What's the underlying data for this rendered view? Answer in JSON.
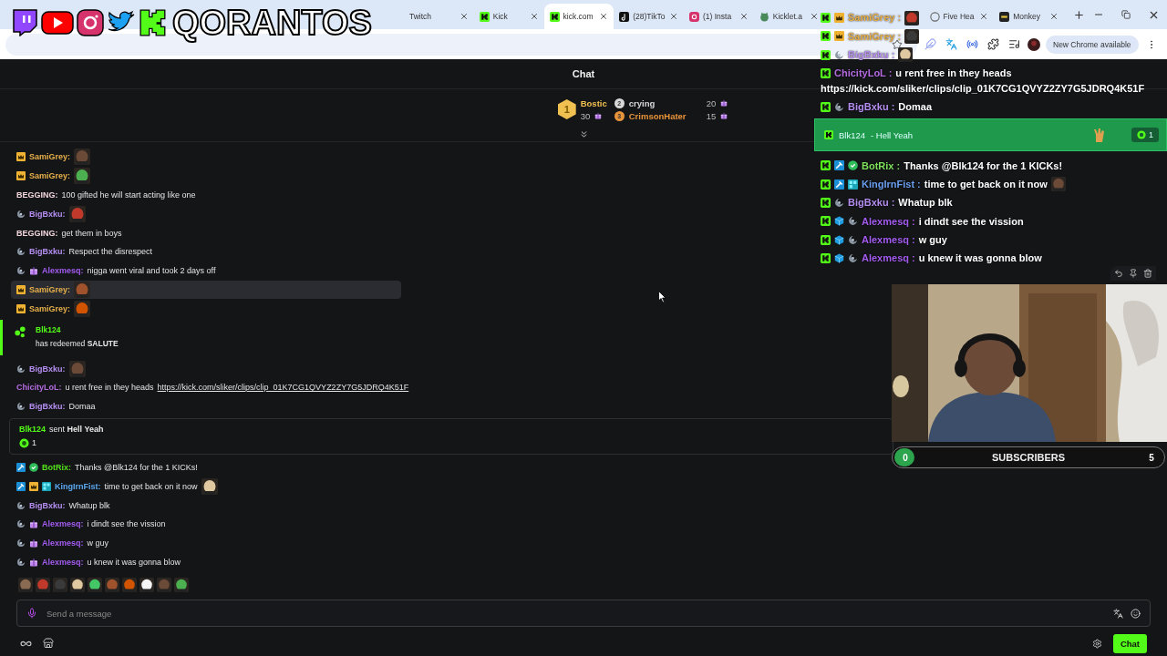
{
  "browser": {
    "tabs": [
      {
        "label": "Twitch",
        "selected": false
      },
      {
        "label": "Kick",
        "selected": false
      },
      {
        "label": "kick.com",
        "selected": true
      },
      {
        "label": "(28)TikTo",
        "selected": false
      },
      {
        "label": "(1) Insta",
        "selected": false
      },
      {
        "label": "Kicklet.a",
        "selected": false
      },
      {
        "label": "Five Hea",
        "selected": false
      },
      {
        "label": "Monkey",
        "selected": false
      }
    ],
    "update_button": "New Chrome available"
  },
  "overlay": {
    "logo": "QORANTOS",
    "chat": [
      {
        "kind": "message",
        "badges": [
          {
            "kind": "kick"
          },
          {
            "kind": "crown"
          }
        ],
        "user": "SamiGrey :",
        "color": "#e8b04a",
        "emote": true
      },
      {
        "kind": "message",
        "badges": [
          {
            "kind": "kick"
          },
          {
            "kind": "crown"
          }
        ],
        "user": "SamiGrey :",
        "color": "#e8b04a",
        "emote": true
      },
      {
        "kind": "message",
        "badges": [
          {
            "kind": "kick"
          },
          {
            "kind": "sub"
          }
        ],
        "user": "BigBxku :",
        "color": "#b48ef0",
        "emote": true
      },
      {
        "kind": "message",
        "badges": [
          {
            "kind": "kick"
          }
        ],
        "user": "ChicityLoL :",
        "color": "#b36be0",
        "text": "u rent free in they heads",
        "link": "https://kick.com/sliker/clips/clip_01K7CG1QVYZ2ZY7G5JDRQ4K51F"
      },
      {
        "kind": "message",
        "badges": [
          {
            "kind": "kick"
          },
          {
            "kind": "sub"
          }
        ],
        "user": "BigBxku :",
        "color": "#b48ef0",
        "text": "Domaa"
      },
      {
        "kind": "alert",
        "user": "Blk124",
        "text": "- Hell Yeah",
        "count": "1"
      },
      {
        "kind": "message",
        "badges": [
          {
            "kind": "kick"
          },
          {
            "kind": "mod"
          },
          {
            "kind": "verified"
          }
        ],
        "user": "BotRix :",
        "color": "#7ee05a",
        "text": "Thanks @Blk124 for the 1 KICKs!"
      },
      {
        "kind": "message",
        "badges": [
          {
            "kind": "kick"
          },
          {
            "kind": "mod"
          },
          {
            "kind": "og"
          }
        ],
        "user": "KingIrnFist :",
        "color": "#6b9ff0",
        "text": "time to get back on it now",
        "emote": true
      },
      {
        "kind": "message",
        "badges": [
          {
            "kind": "kick"
          },
          {
            "kind": "sub"
          }
        ],
        "user": "BigBxku :",
        "color": "#b48ef0",
        "text": "Whatup blk"
      },
      {
        "kind": "message",
        "badges": [
          {
            "kind": "kick"
          },
          {
            "kind": "gem"
          },
          {
            "kind": "sub"
          }
        ],
        "user": "Alexmesq :",
        "color": "#a35cf0",
        "text": "i dindt see the vission"
      },
      {
        "kind": "message",
        "badges": [
          {
            "kind": "kick"
          },
          {
            "kind": "gem"
          },
          {
            "kind": "sub"
          }
        ],
        "user": "Alexmesq :",
        "color": "#a35cf0",
        "text": "w guy"
      },
      {
        "kind": "message",
        "badges": [
          {
            "kind": "kick"
          },
          {
            "kind": "gem"
          },
          {
            "kind": "sub"
          }
        ],
        "user": "Alexmesq :",
        "color": "#a35cf0",
        "text": "u knew it was gonna blow"
      }
    ],
    "subscribers": {
      "current": "0",
      "label": "SUBSCRIBERS",
      "goal": "5",
      "level": 0
    }
  },
  "chat": {
    "title": "Chat",
    "leaderboard": [
      {
        "rank": "1",
        "name": "Bostic",
        "count": "30",
        "color": "#f0c050"
      },
      {
        "rank": "2",
        "name": "crying",
        "count": "20",
        "color": "#d8d8d8"
      },
      {
        "rank": "3",
        "name": "CrimsonHater",
        "count": "15",
        "color": "#e8943a"
      }
    ],
    "messages": [
      {
        "kind": "message",
        "badges": [
          {
            "kind": "crown"
          }
        ],
        "user": "SamiGrey:",
        "color": "#e8b04a",
        "emote": true,
        "selected": false
      },
      {
        "kind": "message",
        "badges": [
          {
            "kind": "crown"
          }
        ],
        "user": "SamiGrey:",
        "color": "#e8b04a",
        "emote": true,
        "selected": false
      },
      {
        "kind": "message",
        "user": "BEGGING:",
        "color": "#f2d6dc",
        "text": "100 gifted he will start acting like one",
        "selected": false
      },
      {
        "kind": "message",
        "badges": [
          {
            "kind": "sub"
          }
        ],
        "user": "BigBxku:",
        "color": "#b48ef0",
        "emote": true,
        "selected": false
      },
      {
        "kind": "message",
        "user": "BEGGING:",
        "color": "#f2d6dc",
        "text": "get them in boys",
        "selected": false
      },
      {
        "kind": "message",
        "badges": [
          {
            "kind": "sub"
          }
        ],
        "user": "BigBxku:",
        "color": "#b48ef0",
        "text": "Respect the disrespect",
        "selected": false
      },
      {
        "kind": "message",
        "badges": [
          {
            "kind": "sub"
          },
          {
            "kind": "gift"
          }
        ],
        "user": "Alexmesq:",
        "color": "#a35cf0",
        "text": "nigga went viral and took 2 days off",
        "selected": false
      },
      {
        "kind": "message",
        "badges": [
          {
            "kind": "crown"
          }
        ],
        "user": "SamiGrey:",
        "color": "#e8b04a",
        "emote": true,
        "selected": true
      },
      {
        "kind": "message",
        "badges": [
          {
            "kind": "crown"
          }
        ],
        "user": "SamiGrey:",
        "color": "#e8b04a",
        "emote": true,
        "selected": false
      },
      {
        "kind": "reward",
        "user": "Blk124",
        "text": "has redeemed **SALUTE**"
      },
      {
        "kind": "message",
        "badges": [
          {
            "kind": "sub"
          }
        ],
        "user": "BigBxku:",
        "color": "#b48ef0",
        "emote": true,
        "selected": false
      },
      {
        "kind": "message",
        "user": "ChicityLoL:",
        "color": "#b36be0",
        "text": "u rent free in they heads",
        "link": "https://kick.com/sliker/clips/clip_01K7CG1QVYZ2ZY7G5JDRQ4K51F",
        "selected": false
      },
      {
        "kind": "message",
        "badges": [
          {
            "kind": "sub"
          }
        ],
        "user": "BigBxku:",
        "color": "#b48ef0",
        "text": "Domaa",
        "selected": false
      },
      {
        "kind": "gift",
        "user": "Blk124",
        "text": "sent **Hell Yeah**",
        "count": "1"
      },
      {
        "kind": "message",
        "badges": [
          {
            "kind": "mod"
          },
          {
            "kind": "verified"
          }
        ],
        "user": "BotRix:",
        "color": "#53e01a",
        "text": "Thanks @Blk124 for the 1 KICKs!",
        "selected": false
      },
      {
        "kind": "message",
        "badges": [
          {
            "kind": "mod"
          },
          {
            "kind": "crown"
          },
          {
            "kind": "og"
          }
        ],
        "user": "KingIrnFist:",
        "color": "#5ba8f0",
        "text": "time to get back on it now",
        "emote": true,
        "selected": false
      },
      {
        "kind": "message",
        "badges": [
          {
            "kind": "sub"
          }
        ],
        "user": "BigBxku:",
        "color": "#b48ef0",
        "text": "Whatup blk",
        "selected": false
      },
      {
        "kind": "message",
        "badges": [
          {
            "kind": "sub"
          },
          {
            "kind": "gift"
          }
        ],
        "user": "Alexmesq:",
        "color": "#a35cf0",
        "text": "i dindt see the vission",
        "selected": false
      },
      {
        "kind": "message",
        "badges": [
          {
            "kind": "sub"
          },
          {
            "kind": "gift"
          }
        ],
        "user": "Alexmesq:",
        "color": "#a35cf0",
        "text": "w guy",
        "selected": false
      },
      {
        "kind": "message",
        "badges": [
          {
            "kind": "sub"
          },
          {
            "kind": "gift"
          }
        ],
        "user": "Alexmesq:",
        "color": "#a35cf0",
        "text": "u knew it was gonna blow",
        "selected": false
      }
    ],
    "input": {
      "placeholder": "Send a message"
    },
    "send_button": "Chat"
  }
}
